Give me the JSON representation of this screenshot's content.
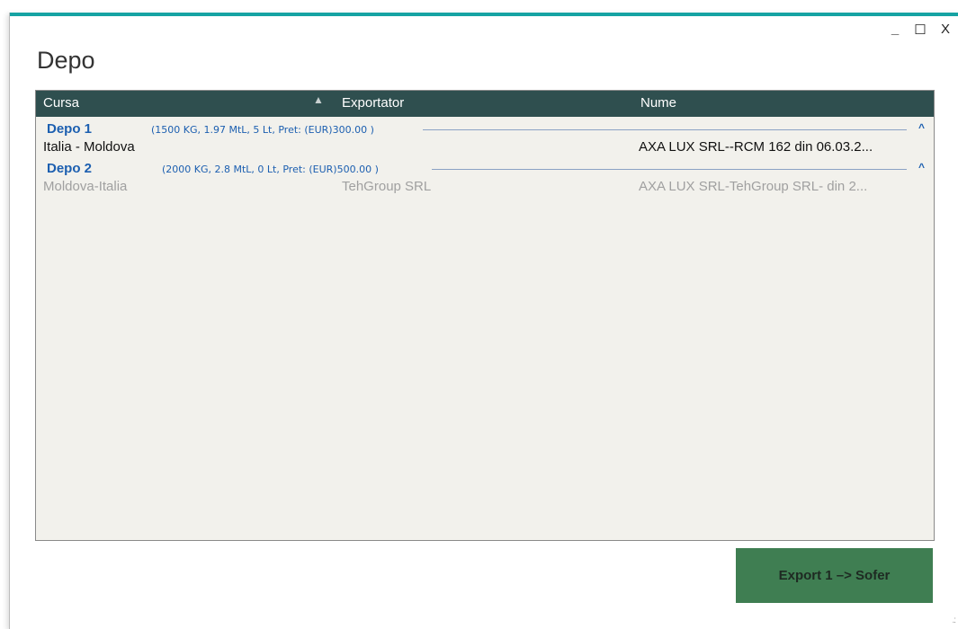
{
  "window": {
    "title": "Depo",
    "controls": {
      "minimize": "_",
      "maximize": "☐",
      "close": "X"
    }
  },
  "grid": {
    "columns": [
      "Cursa",
      "Exportator",
      "Nume"
    ],
    "groups": [
      {
        "name": "Depo 1",
        "summary": "(1500 KG, 1.97 MtL, 5 Lt, Pret: (EUR)300.00 )",
        "rows": [
          {
            "cursa": "Italia - Moldova",
            "exportator": "",
            "nume": "AXA LUX SRL--RCM 162 din 06.03.2..."
          }
        ]
      },
      {
        "name": "Depo 2",
        "summary": "(2000 KG, 2.8 MtL, 0 Lt, Pret: (EUR)500.00 )",
        "rows": [
          {
            "cursa": "Moldova-Italia",
            "exportator": "TehGroup SRL",
            "nume": "AXA LUX SRL-TehGroup SRL- din 2..."
          }
        ]
      }
    ]
  },
  "export_button": {
    "label": "Export 1 –> Sofer"
  },
  "colors": {
    "accent": "#16a3a3",
    "header_bg": "#2f4f4f",
    "group_text": "#1c5fb0",
    "button_bg": "#3f7e52"
  },
  "icons": {
    "sort": "sort-ascending-icon",
    "collapse": "chevron-up-icon",
    "grip": "resize-grip-icon"
  }
}
